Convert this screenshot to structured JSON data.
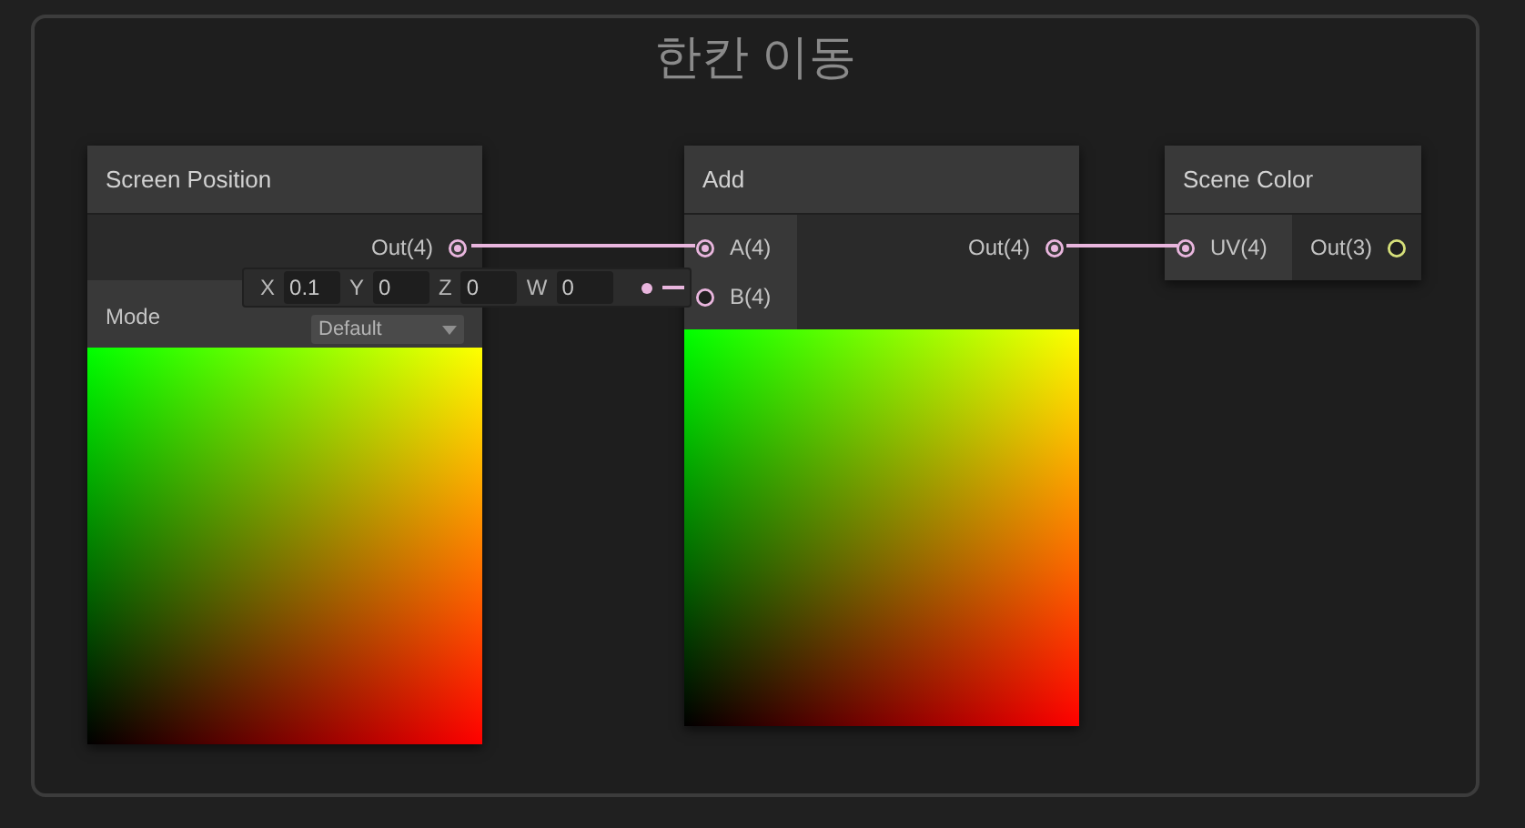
{
  "group": {
    "title": "한칸 이동"
  },
  "nodes": [
    {
      "title": "Screen Position",
      "outputs": [
        {
          "label": "Out(4)",
          "connected": true,
          "color": "#e9b6de"
        }
      ],
      "mode": {
        "label": "Mode",
        "value": "Default"
      },
      "preview": true
    },
    {
      "title": "Add",
      "inputs": [
        {
          "label": "A(4)",
          "connected": true,
          "color": "#e9b6de"
        },
        {
          "label": "B(4)",
          "connected": false,
          "color": "#e9b6de"
        }
      ],
      "outputs": [
        {
          "label": "Out(4)",
          "connected": true,
          "color": "#e9b6de"
        }
      ],
      "preview": true
    },
    {
      "title": "Scene Color",
      "inputs": [
        {
          "label": "UV(4)",
          "connected": true,
          "color": "#e9b6de"
        }
      ],
      "outputs": [
        {
          "label": "Out(3)",
          "connected": false,
          "color": "#d6e07a"
        }
      ],
      "preview": false
    }
  ],
  "vector_field": {
    "fields": [
      {
        "axis": "X",
        "value": "0.1"
      },
      {
        "axis": "Y",
        "value": "0"
      },
      {
        "axis": "Z",
        "value": "0"
      },
      {
        "axis": "W",
        "value": "0"
      }
    ],
    "color": "#e9b6de"
  }
}
